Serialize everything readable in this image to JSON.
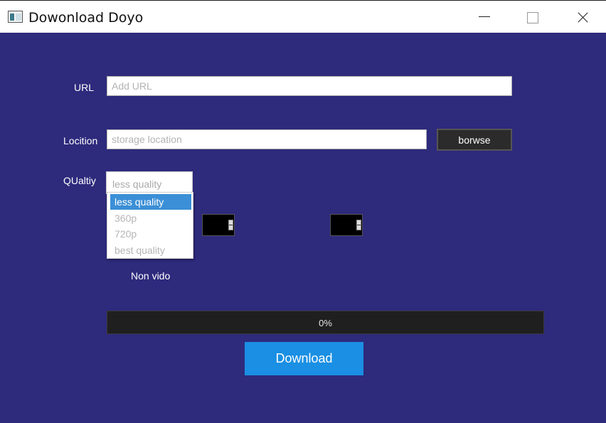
{
  "window": {
    "title": "Dowonload Doyo",
    "icon": "app-icon",
    "controls": [
      "minimize-icon",
      "maximize-icon",
      "close-icon"
    ]
  },
  "form": {
    "url_label": "URL",
    "url_placeholder": "Add URL",
    "url_value": "",
    "location_label": "Locition",
    "location_placeholder": "storage location",
    "location_value": "",
    "browse_label": "borwse",
    "quality_label": "QUaltiy",
    "quality_selected": "less quality",
    "quality_options": [
      "less quality",
      "360p",
      "720p",
      "best quality"
    ],
    "status_text": "Non vido"
  },
  "progress": {
    "value": 0,
    "text": "0%"
  },
  "download_label": "Download",
  "colors": {
    "background": "#2e2a7c",
    "accent": "#1a8fe3",
    "selection": "#3b8fd6",
    "dark_control": "#2b2b2b"
  }
}
